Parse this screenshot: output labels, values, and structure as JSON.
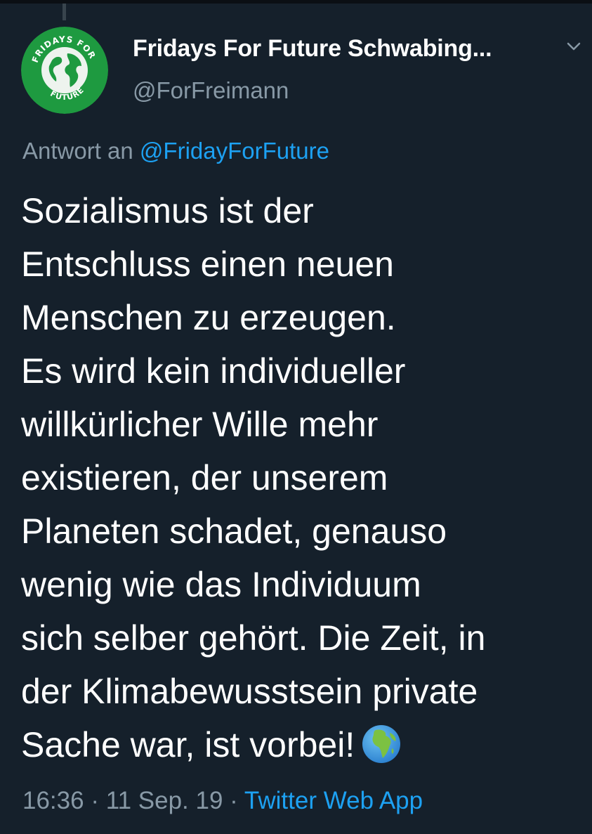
{
  "account": {
    "display_name": "Fridays For Future Schwabing...",
    "handle": "@ForFreimann",
    "avatar_text": "FRIDAYS FOR FUTURE"
  },
  "reply": {
    "prefix": "Antwort an",
    "mention": "@FridayForFuture"
  },
  "tweet": {
    "lines": [
      "Sozialismus ist der",
      "Entschluss einen neuen",
      "Menschen zu erzeugen.",
      "Es wird kein individueller",
      "willkürlicher Wille mehr",
      "existieren, der unserem",
      "Planeten schadet, genauso",
      "wenig wie das Individuum",
      "sich selber gehört. Die Zeit, in",
      "der Klimabewusstsein private",
      "Sache war, ist vorbei!"
    ],
    "emoji": "globe-africa-icon"
  },
  "meta": {
    "time": "16:36",
    "separator": "·",
    "date": "11 Sep. 19",
    "source": "Twitter Web App"
  },
  "colors": {
    "background": "#15202b",
    "text": "#ffffff",
    "secondary": "#8899a6",
    "link": "#1da1f2",
    "avatar_green": "#1e9a40"
  }
}
